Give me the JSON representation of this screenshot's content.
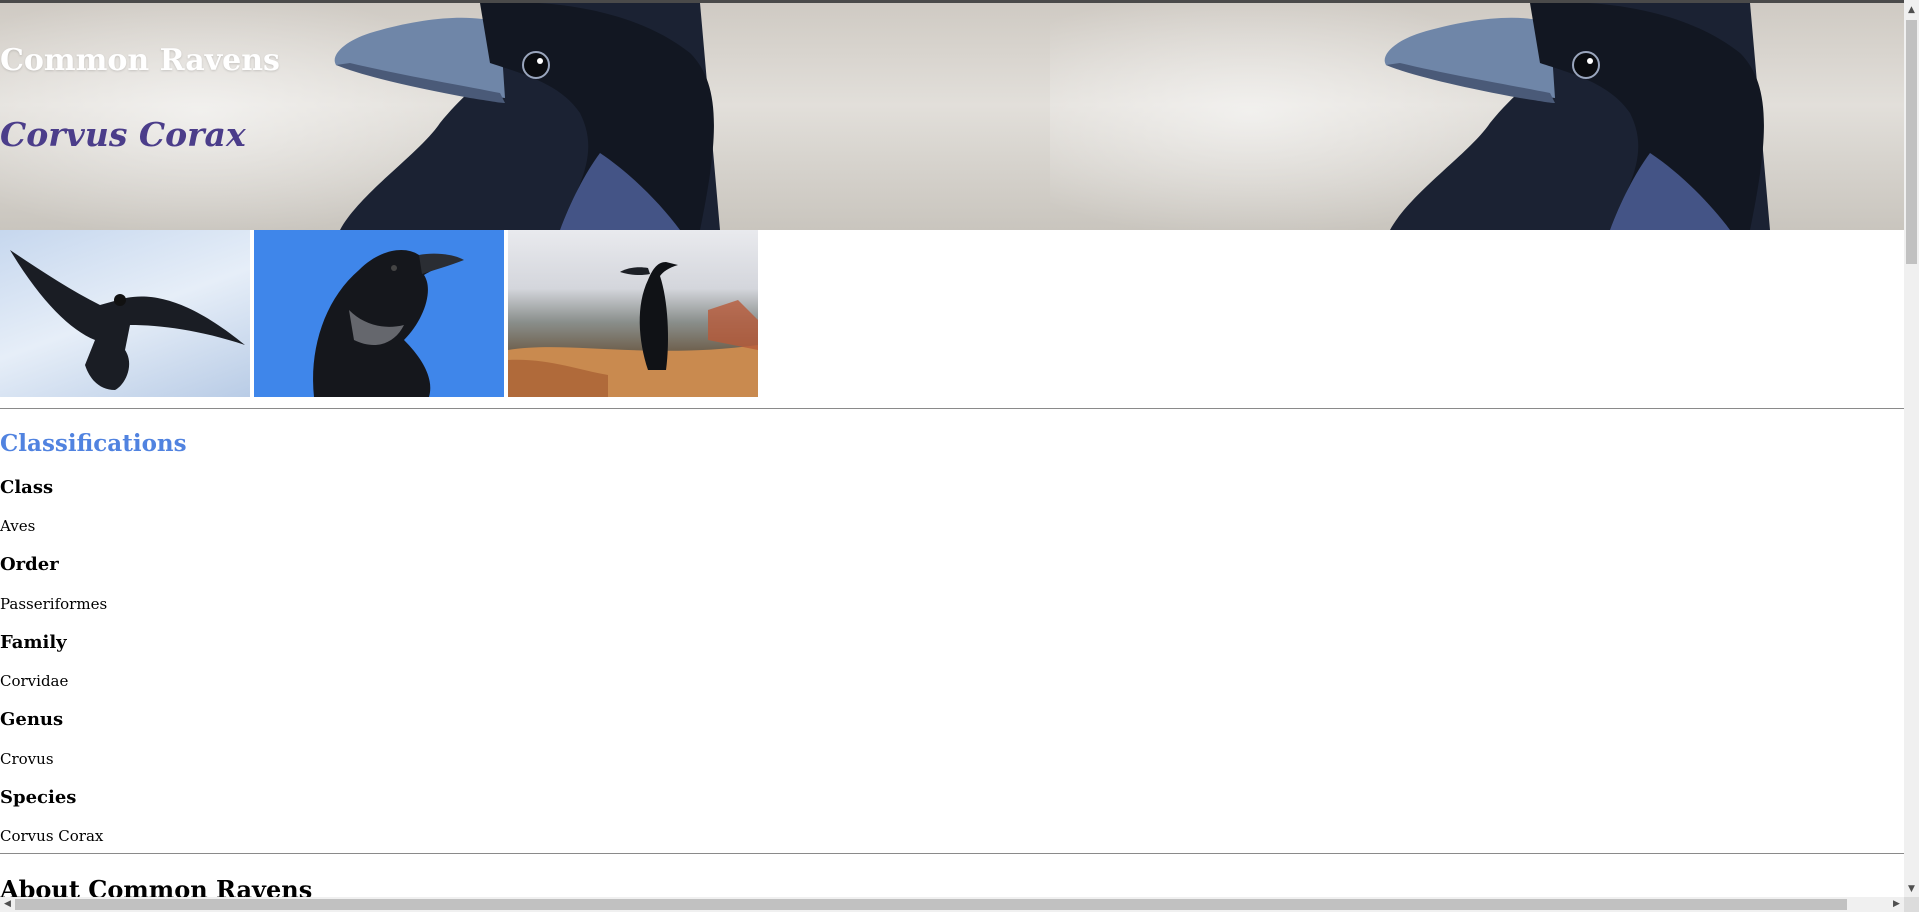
{
  "hero": {
    "title": "Common Ravens",
    "subtitle": "Corvus Corax"
  },
  "gallery": {
    "photos": [
      {
        "name": "raven-in-flight"
      },
      {
        "name": "raven-portrait-blue-sky"
      },
      {
        "name": "raven-perched-canyon"
      }
    ]
  },
  "classifications": {
    "heading": "Classifications",
    "items": [
      {
        "term": "Class",
        "value": "Aves"
      },
      {
        "term": "Order",
        "value": "Passeriformes"
      },
      {
        "term": "Family",
        "value": "Corvidae"
      },
      {
        "term": "Genus",
        "value": "Crovus"
      },
      {
        "term": "Species",
        "value": "Corvus Corax"
      }
    ]
  },
  "about": {
    "heading": "About Common Ravens"
  },
  "scrollbars": {
    "up_glyph": "▲",
    "down_glyph": "▼",
    "left_glyph": "◀",
    "right_glyph": "▶"
  },
  "colors": {
    "heading_accent": "#5183e0",
    "subtitle": "#4b3d8a"
  }
}
